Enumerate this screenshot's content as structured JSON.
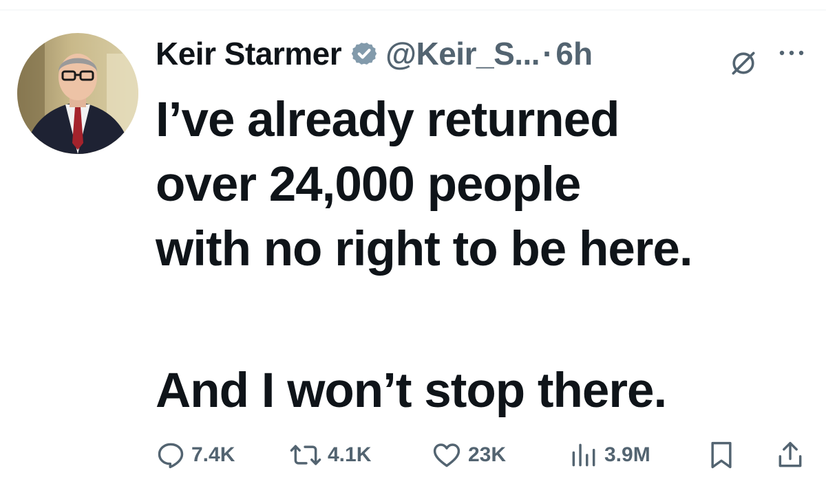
{
  "tweet": {
    "author_name": "Keir Starmer",
    "handle": "@Keir_S...",
    "separator": "·",
    "time": "6h",
    "text_line1": "I’ve already returned",
    "text_line2": "over 24,000 people",
    "text_line3": "with no right to be here.",
    "text_line4": "And I won’t stop there."
  },
  "actions": {
    "replies": "7.4K",
    "reposts": "4.1K",
    "likes": "23K",
    "views": "3.9M"
  },
  "icons": {
    "verified": "verified-badge-icon",
    "grok": "grok-icon",
    "more": "more-icon",
    "reply": "reply-icon",
    "repost": "repost-icon",
    "like": "heart-icon",
    "views": "views-icon",
    "bookmark": "bookmark-icon",
    "share": "share-icon"
  },
  "colors": {
    "text": "#0f1419",
    "secondary": "#536471",
    "verified_badge": "#829aab"
  }
}
